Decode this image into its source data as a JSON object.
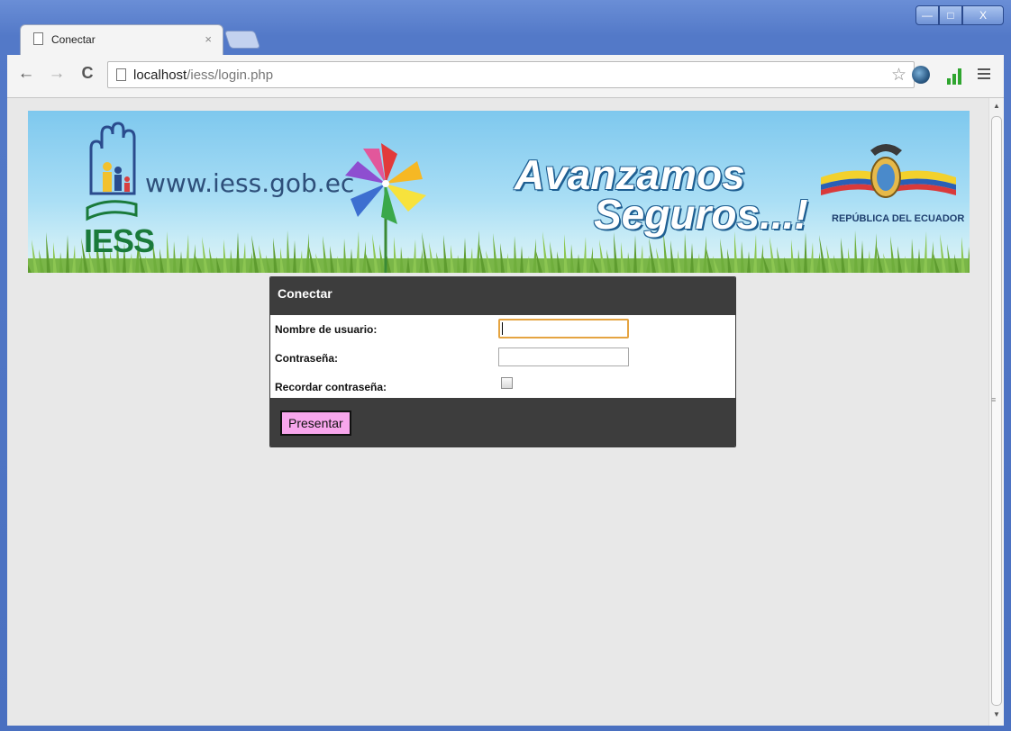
{
  "tab": {
    "title": "Conectar",
    "close": "×"
  },
  "toolbar": {
    "back": "←",
    "forward": "→",
    "reload": "C",
    "url_host": "localhost",
    "url_path": "/iess/login.php",
    "star": "☆"
  },
  "window_controls": {
    "minimize": "—",
    "maximize": "□",
    "close": "X"
  },
  "banner": {
    "logo_text": "IESS",
    "site_url": "www.iess.gob.ec",
    "slogan_line1": "Avanzamos",
    "slogan_line2": "Seguros...!",
    "republica": "REPÚBLICA DEL ECUADOR"
  },
  "login": {
    "title": "Conectar",
    "username_label": "Nombre de usuario:",
    "password_label": "Contraseña:",
    "remember_label": "Recordar contraseña:",
    "submit_label": "Presentar"
  },
  "colors": {
    "panel_dark": "#3d3d3d",
    "submit_bg": "#f7a6ec",
    "focus_border": "#e5a441",
    "page_bg": "#e8e8e8"
  }
}
